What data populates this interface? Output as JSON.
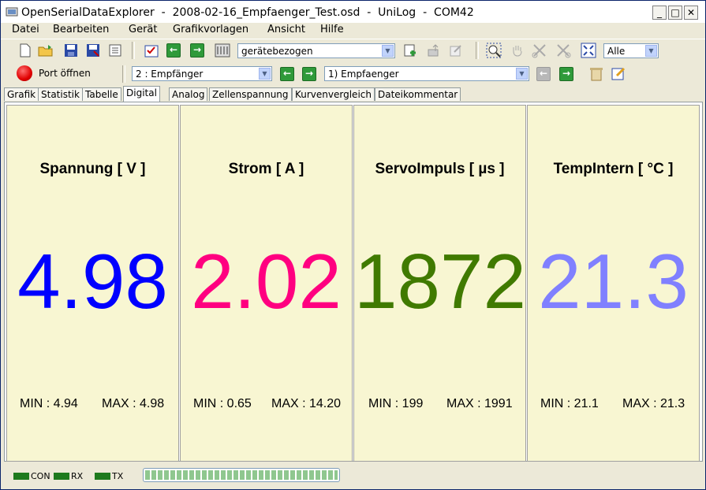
{
  "window": {
    "title": "OpenSerialDataExplorer  -  2008-02-16_Empfaenger_Test.osd  -  UniLog  -  COM42",
    "buttons": {
      "minimize": "_",
      "maximize": "□",
      "close": "✕"
    }
  },
  "menu": [
    "Datei",
    "Bearbeiten",
    "Gerät",
    "Grafikvorlagen",
    "Ansicht",
    "Hilfe"
  ],
  "toolbar": {
    "view_mode": "gerätebezogen",
    "range_select": "Alle",
    "port_label": "Port öffnen",
    "device_select": "2 : Empfänger",
    "record_select": "1) Empfaenger"
  },
  "tabs": [
    "Grafik",
    "Statistik",
    "Tabelle",
    "Digital",
    "Analog",
    "Zellenspannung",
    "Kurvenvergleich",
    "Dateikommentar"
  ],
  "active_tab": "Digital",
  "measurements": [
    {
      "name": "Spannung [ V ]",
      "value": "4.98",
      "color": "#0000ff",
      "min": "MIN : 4.94",
      "max": "MAX : 4.98"
    },
    {
      "name": "Strom [ A ]",
      "value": "2.02",
      "color": "#ff0080",
      "min": "MIN : 0.65",
      "max": "MAX : 14.20"
    },
    {
      "name": "ServoImpuls [ µs ]",
      "value": "1872",
      "color": "#407a00",
      "min": "MIN : 199",
      "max": "MAX : 1991"
    },
    {
      "name": "TempIntern [ °C ]",
      "value": "21.3",
      "color": "#8080ff",
      "min": "MIN : 21.1",
      "max": "MAX : 21.3"
    }
  ],
  "status": {
    "leds": [
      "CON",
      "RX",
      "TX"
    ],
    "led_color": "#1e7a1e",
    "progress_fraction": 1.0
  }
}
